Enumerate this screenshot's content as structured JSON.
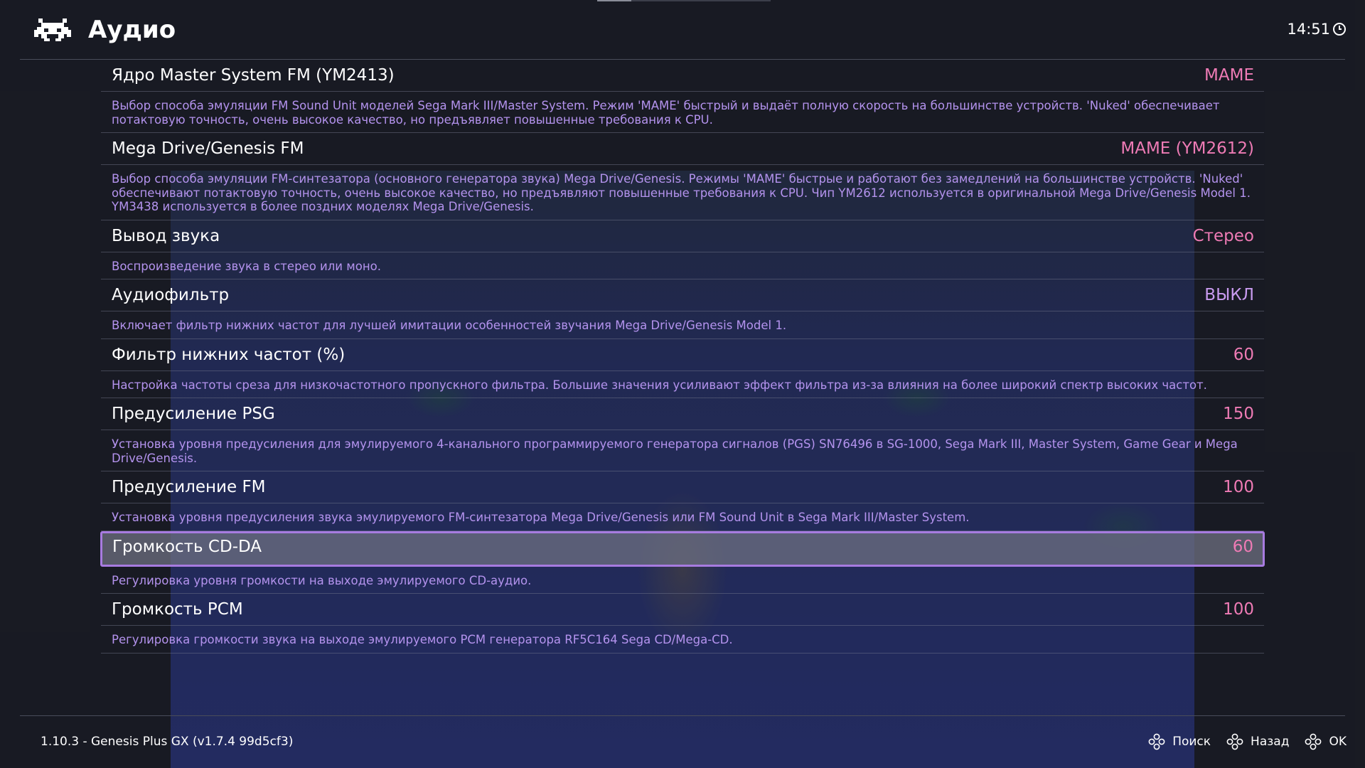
{
  "header": {
    "title": "Аудио",
    "clock": "14:51"
  },
  "settings": [
    {
      "label": "Ядро Master System FM (YM2413)",
      "value": "MAME",
      "description": "Выбор способа эмуляции FM Sound Unit моделей Sega Mark III/Master System. Режим 'MAME' быстрый и выдаёт полную скорость на большинстве устройств. 'Nuked' обеспечивает потактовую точность, очень высокое качество, но предъявляет повышенные требования к CPU."
    },
    {
      "label": "Mega Drive/Genesis FM",
      "value": "MAME (YM2612)",
      "description": "Выбор способа эмуляции FM-синтезатора (основного генератора звука) Mega Drive/Genesis. Режимы 'MAME' быстрые и работают без замедлений на большинстве устройств. 'Nuked' обеспечивают потактовую точность, очень высокое качество, но предъявляют повышенные требования к CPU. Чип YM2612 используется в оригинальной Mega Drive/Genesis Model 1. YM3438 используется в более поздних моделях Mega Drive/Genesis."
    },
    {
      "label": "Вывод звука",
      "value": "Стерео",
      "description": "Воспроизведение звука в стерео или моно."
    },
    {
      "label": "Аудиофильтр",
      "value": "ВЫКЛ",
      "value_state": "off",
      "description": "Включает фильтр нижних частот для лучшей имитации особенностей звучания Mega Drive/Genesis Model 1."
    },
    {
      "label": "Фильтр нижних частот (%)",
      "value": "60",
      "description": "Настройка частоты среза для низкочастотного пропускного фильтра. Большие значения усиливают эффект фильтра из-за влияния на более широкий спектр высоких частот."
    },
    {
      "label": "Предусиление PSG",
      "value": "150",
      "description": "Установка уровня предусиления для эмулируемого 4-канального программируемого генератора сигналов (PGS) SN76496 в SG-1000, Sega Mark III, Master System, Game Gear и Mega Drive/Genesis."
    },
    {
      "label": "Предусиление FM",
      "value": "100",
      "description": "Установка уровня предусиления звука эмулируемого FM-синтезатора Mega Drive/Genesis или FM Sound Unit в Sega Mark III/Master System."
    },
    {
      "label": "Громкость CD-DA",
      "value": "60",
      "selected": true,
      "description": "Регулировка уровня громкости на выходе эмулируемого CD-аудио."
    },
    {
      "label": "Громкость PCM",
      "value": "100",
      "description": "Регулировка громкости звука на выходе эмулируемого PCM генератора RF5C164 Sega CD/Mega-CD."
    }
  ],
  "footer": {
    "core_info": "1.10.3 - Genesis Plus GX (v1.7.4 99d5cf3)",
    "hints": [
      {
        "icon": "gamepad-buttons-icon",
        "label": "Поиск"
      },
      {
        "icon": "gamepad-buttons-icon",
        "label": "Назад"
      },
      {
        "icon": "gamepad-buttons-icon",
        "label": "OK"
      }
    ]
  },
  "colors": {
    "value_accent": "#ee7bb5",
    "value_off": "#c99bf0",
    "description_text": "#b493ee",
    "selection_border": "#a77be0"
  }
}
